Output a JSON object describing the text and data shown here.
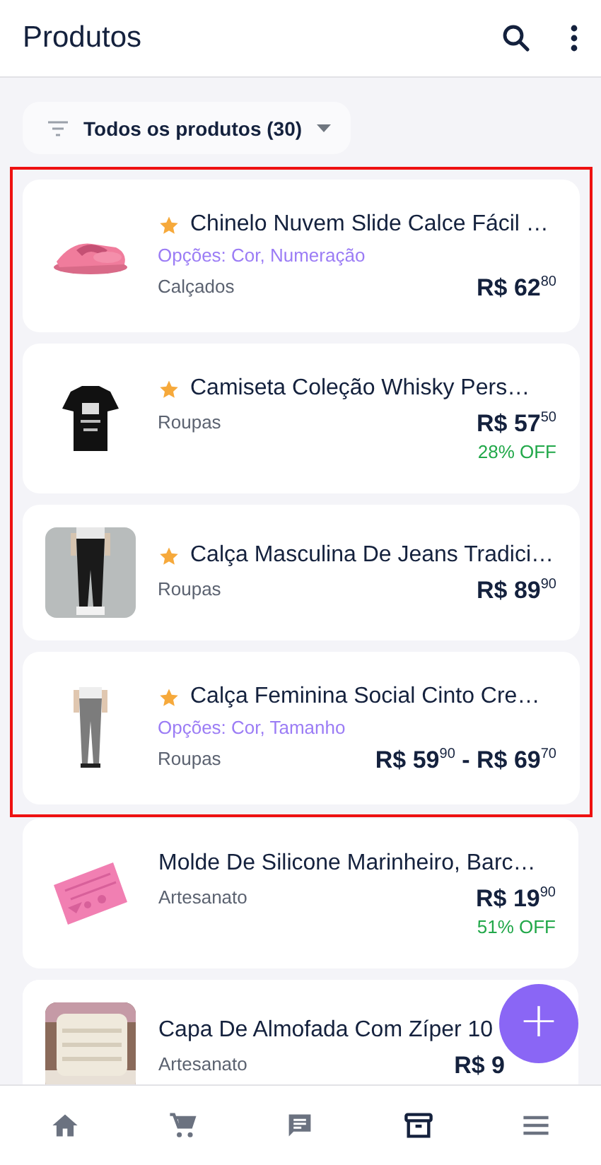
{
  "header": {
    "title": "Produtos"
  },
  "filter": {
    "label": "Todos os produtos (30)"
  },
  "products": [
    {
      "title": "Chinelo Nuvem Slide Calce Fácil …",
      "starred": true,
      "options": "Opções: Cor, Numeração",
      "category": "Calçados",
      "price": "R$ 62$^{80}$",
      "highlighted": true,
      "covered": false
    },
    {
      "title": "Camiseta Coleção Whisky Pers…",
      "starred": true,
      "category": "Roupas",
      "price": "R$ 57$^{50}$",
      "discount": "28% OFF",
      "highlighted": true,
      "covered": false
    },
    {
      "title": "Calça Masculina De Jeans Tradici…",
      "starred": true,
      "category": "Roupas",
      "price": "R$ 89$^{90}$",
      "highlighted": true,
      "covered": false
    },
    {
      "title": "Calça Feminina Social Cinto Cre…",
      "starred": true,
      "options": "Opções: Cor, Tamanho",
      "category": "Roupas",
      "price": "R$ 59$^{90}$ - R$ 69$^{70}$",
      "highlighted": true,
      "covered": false
    },
    {
      "title": "Molde De Silicone Marinheiro, Barc…",
      "starred": false,
      "category": "Artesanato",
      "price": "R$ 19$^{90}$",
      "discount": "51% OFF",
      "highlighted": false,
      "covered": false
    },
    {
      "title": "Capa De Almofada Com Zíper 10",
      "starred": false,
      "category": "Artesanato",
      "price": "R$ 9",
      "highlighted": false,
      "covered": true
    }
  ],
  "fab": {
    "label": "+"
  },
  "nav": [
    {
      "kind": "home",
      "selected": false
    },
    {
      "kind": "cart",
      "selected": false
    },
    {
      "kind": "chat",
      "selected": false
    },
    {
      "kind": "archive",
      "selected": true
    },
    {
      "kind": "menu",
      "selected": false
    }
  ]
}
